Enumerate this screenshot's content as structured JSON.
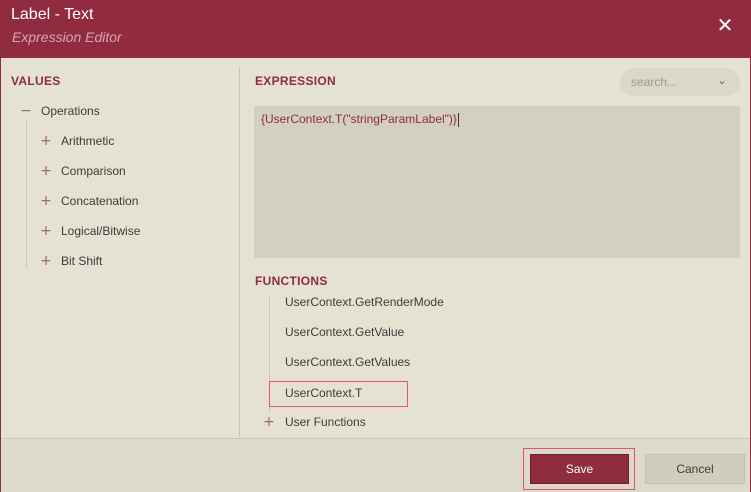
{
  "dialog": {
    "title": "Label - Text",
    "subtitle": "Expression Editor",
    "close_icon": "close-icon"
  },
  "values": {
    "heading": "VALUES",
    "root": {
      "label": "Operations",
      "toggle": "−"
    },
    "children": [
      {
        "label": "Arithmetic",
        "toggle": "+"
      },
      {
        "label": "Comparison",
        "toggle": "+"
      },
      {
        "label": "Concatenation",
        "toggle": "+"
      },
      {
        "label": "Logical/Bitwise",
        "toggle": "+"
      },
      {
        "label": "Bit Shift",
        "toggle": "+"
      }
    ]
  },
  "expression": {
    "heading": "EXPRESSION",
    "value": "{UserContext.T(\"stringParamLabel\")}",
    "search_placeholder": "search...",
    "search_dropdown_icon": "chevron-down-icon"
  },
  "functions": {
    "heading": "FUNCTIONS",
    "items": [
      {
        "label": "UserContext.GetRenderMode"
      },
      {
        "label": "UserContext.GetValue"
      },
      {
        "label": "UserContext.GetValues"
      },
      {
        "label": "UserContext.T",
        "highlighted": true
      }
    ],
    "group": {
      "label": "User Functions",
      "toggle": "+"
    }
  },
  "footer": {
    "save_label": "Save",
    "cancel_label": "Cancel"
  },
  "colors": {
    "brand": "#912c40",
    "panel_bg": "#e5e1d3",
    "highlight": "#e05a5a"
  }
}
